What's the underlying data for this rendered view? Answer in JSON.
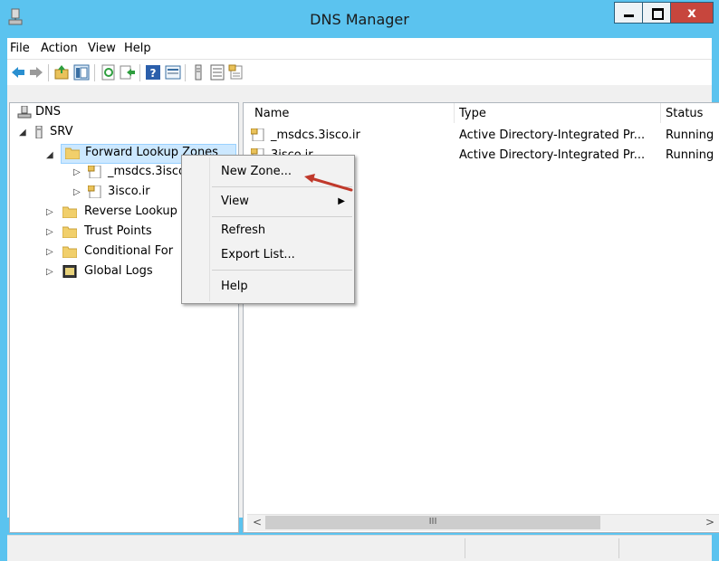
{
  "window": {
    "title": "DNS Manager"
  },
  "menubar": {
    "items": [
      "File",
      "Action",
      "View",
      "Help"
    ]
  },
  "toolbar": {
    "icons": [
      "back-arrow-icon",
      "forward-arrow-icon",
      "up-folder-icon",
      "show-hide-tree-icon",
      "refresh-icon",
      "export-list-icon",
      "help-icon",
      "properties-icon",
      "server-icon",
      "list-icon",
      "zone-icon"
    ]
  },
  "tree": {
    "root": "DNS",
    "server": "SRV",
    "forward": "Forward Lookup Zones",
    "zone1": "_msdcs.3isco",
    "zone2": "3isco.ir",
    "reverse": "Reverse Lookup",
    "trust": "Trust Points",
    "conditional": "Conditional For",
    "logs": "Global Logs"
  },
  "list": {
    "headers": {
      "name": "Name",
      "type": "Type",
      "status": "Status"
    },
    "rows": [
      {
        "name": "_msdcs.3isco.ir",
        "type": "Active Directory-Integrated Pr...",
        "status": "Running"
      },
      {
        "name": "3isco.ir",
        "type": "Active Directory-Integrated Pr...",
        "status": "Running"
      }
    ]
  },
  "context_menu": {
    "new_zone": "New Zone...",
    "view": "View",
    "refresh": "Refresh",
    "export": "Export List...",
    "help": "Help"
  },
  "scrollbar": {
    "thumb_glyph": "III"
  },
  "colors": {
    "titlebar": "#5bc3ef",
    "close": "#c7463d",
    "selection": "#cce8ff",
    "annotation_arrow": "#c0392b"
  }
}
